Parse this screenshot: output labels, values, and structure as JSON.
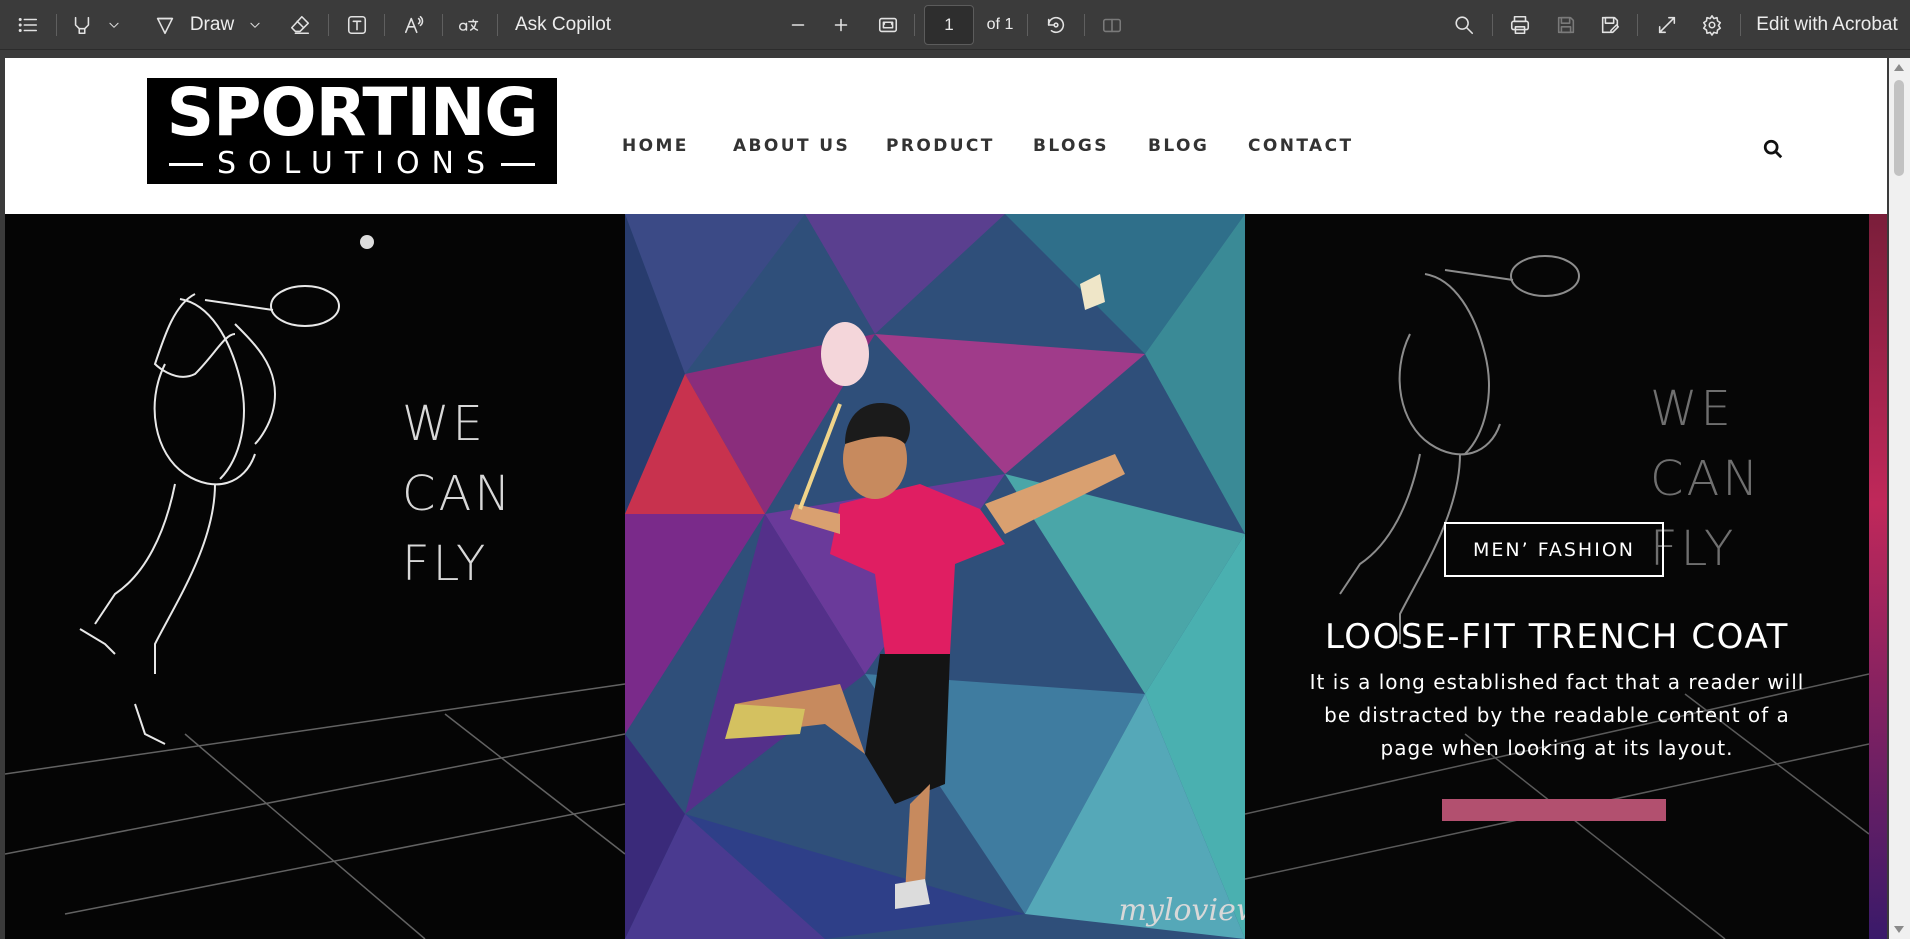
{
  "toolbar": {
    "draw_label": "Draw",
    "ask_copilot_label": "Ask Copilot",
    "page_current": "1",
    "page_total": "of 1",
    "edit_acrobat_label": "Edit with Acrobat",
    "icons": [
      "contents-icon",
      "highlight-icon",
      "draw-icon",
      "eraser-icon",
      "text-box-icon",
      "read-aloud-icon",
      "translate-icon",
      "zoom-out-icon",
      "zoom-in-icon",
      "fit-page-icon",
      "rotate-icon",
      "page-view-icon",
      "search-icon",
      "print-icon",
      "save-icon",
      "save-as-icon",
      "fullscreen-icon",
      "settings-icon"
    ]
  },
  "site": {
    "logo_top": "SPORTING",
    "logo_bottom": "SOLUTIONS",
    "nav": [
      "HOME",
      "ABOUT US",
      "PRODUCT",
      "BLOGS",
      "BLOG",
      "CONTACT"
    ],
    "slogan_lines": [
      "WE",
      "CAN",
      "FLY"
    ],
    "slide": {
      "tag": "MEN’ FASHION",
      "title": "LOOSE-FIT TRENCH COAT",
      "body": "It is a long established fact that a reader will be distracted by the readable content of a page when looking at its layout.",
      "accent_color": "#b2506f"
    },
    "watermark": "myloview"
  }
}
